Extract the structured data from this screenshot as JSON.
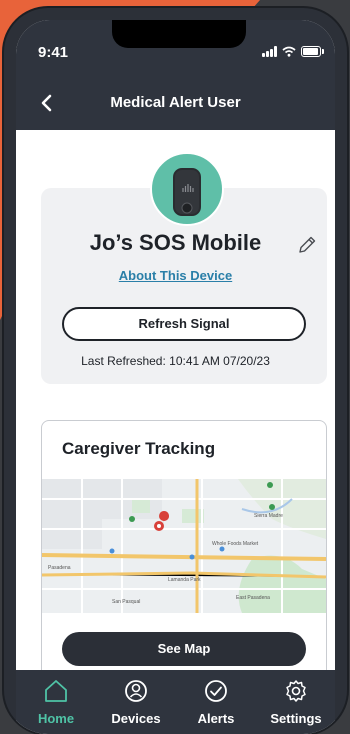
{
  "status_bar": {
    "time": "9:41"
  },
  "header": {
    "title": "Medical Alert User"
  },
  "device": {
    "name": "Jo’s SOS Mobile",
    "about_link": "About This Device",
    "refresh_label": "Refresh Signal",
    "last_refreshed": "Last Refreshed: 10:41 AM 07/20/23"
  },
  "tracking": {
    "title": "Caregiver Tracking",
    "see_map_label": "See Map",
    "map_labels": [
      "Sierra Madre",
      "Pasadena",
      "East Pasadena",
      "Lamanda Park",
      "San Pasqual",
      "Whole Foods Market"
    ]
  },
  "tabs": [
    {
      "label": "Home",
      "icon": "home-icon",
      "active": true
    },
    {
      "label": "Devices",
      "icon": "devices-icon",
      "active": false
    },
    {
      "label": "Alerts",
      "icon": "alerts-icon",
      "active": false
    },
    {
      "label": "Settings",
      "icon": "settings-icon",
      "active": false
    }
  ],
  "colors": {
    "accent": "#4fc3a6",
    "header_bg": "#2f343e",
    "background_orange": "#e8633a",
    "link": "#2a7fa8"
  }
}
